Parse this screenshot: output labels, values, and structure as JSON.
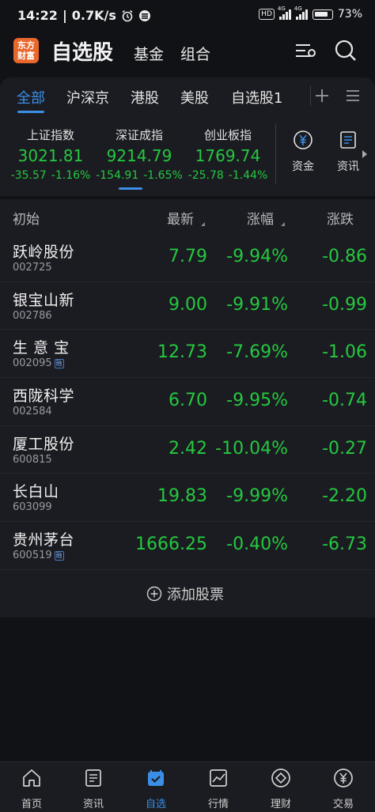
{
  "status_bar": {
    "time": "14:22",
    "speed": "0.7K/s",
    "hd": "HD",
    "net1": "4G",
    "net2": "4G",
    "battery": "73%"
  },
  "header": {
    "logo_line1": "东方",
    "logo_line2": "财富",
    "title": "自选股",
    "link_fund": "基金",
    "link_portfolio": "组合"
  },
  "tabs": [
    {
      "label": "全部",
      "active": true
    },
    {
      "label": "沪深京"
    },
    {
      "label": "港股"
    },
    {
      "label": "美股"
    },
    {
      "label": "自选股1"
    }
  ],
  "indices": [
    {
      "name": "上证指数",
      "value": "3021.81",
      "change": "-35.57",
      "pct": "-1.16%"
    },
    {
      "name": "深证成指",
      "value": "9214.79",
      "change": "-154.91",
      "pct": "-1.65%"
    },
    {
      "name": "创业板指",
      "value": "1769.74",
      "change": "-25.78",
      "pct": "-1.44%"
    }
  ],
  "quick_links": [
    {
      "label": "资金",
      "icon": "yen-circle-icon"
    },
    {
      "label": "资讯",
      "icon": "document-icon"
    }
  ],
  "table": {
    "columns": {
      "initial": "初始",
      "latest": "最新",
      "pct": "涨幅",
      "change": "涨跌"
    },
    "rows": [
      {
        "name": "跃岭股份",
        "code": "002725",
        "rong": "",
        "price": "7.79",
        "pct": "-9.94%",
        "change": "-0.86"
      },
      {
        "name": "银宝山新",
        "code": "002786",
        "rong": "",
        "price": "9.00",
        "pct": "-9.91%",
        "change": "-0.99"
      },
      {
        "name": "生 意 宝",
        "code": "002095",
        "rong": "融",
        "price": "12.73",
        "pct": "-7.69%",
        "change": "-1.06"
      },
      {
        "name": "西陇科学",
        "code": "002584",
        "rong": "",
        "price": "6.70",
        "pct": "-9.95%",
        "change": "-0.74"
      },
      {
        "name": "厦工股份",
        "code": "600815",
        "rong": "",
        "price": "2.42",
        "pct": "-10.04%",
        "change": "-0.27"
      },
      {
        "name": "长白山",
        "code": "603099",
        "rong": "",
        "price": "19.83",
        "pct": "-9.99%",
        "change": "-2.20"
      },
      {
        "name": "贵州茅台",
        "code": "600519",
        "rong": "融",
        "price": "1666.25",
        "pct": "-0.40%",
        "change": "-6.73"
      }
    ],
    "add_label": "添加股票"
  },
  "bottom_nav": [
    {
      "label": "首页",
      "icon": "home-icon"
    },
    {
      "label": "资讯",
      "icon": "news-icon"
    },
    {
      "label": "自选",
      "icon": "watchlist-icon",
      "active": true
    },
    {
      "label": "行情",
      "icon": "chart-icon"
    },
    {
      "label": "理财",
      "icon": "diamond-icon"
    },
    {
      "label": "交易",
      "icon": "yen-icon"
    }
  ],
  "colors": {
    "accent": "#3a8ee6",
    "down": "#25c840",
    "bg": "#111216",
    "panel": "#1b1c21",
    "logo": "#e9672c"
  }
}
